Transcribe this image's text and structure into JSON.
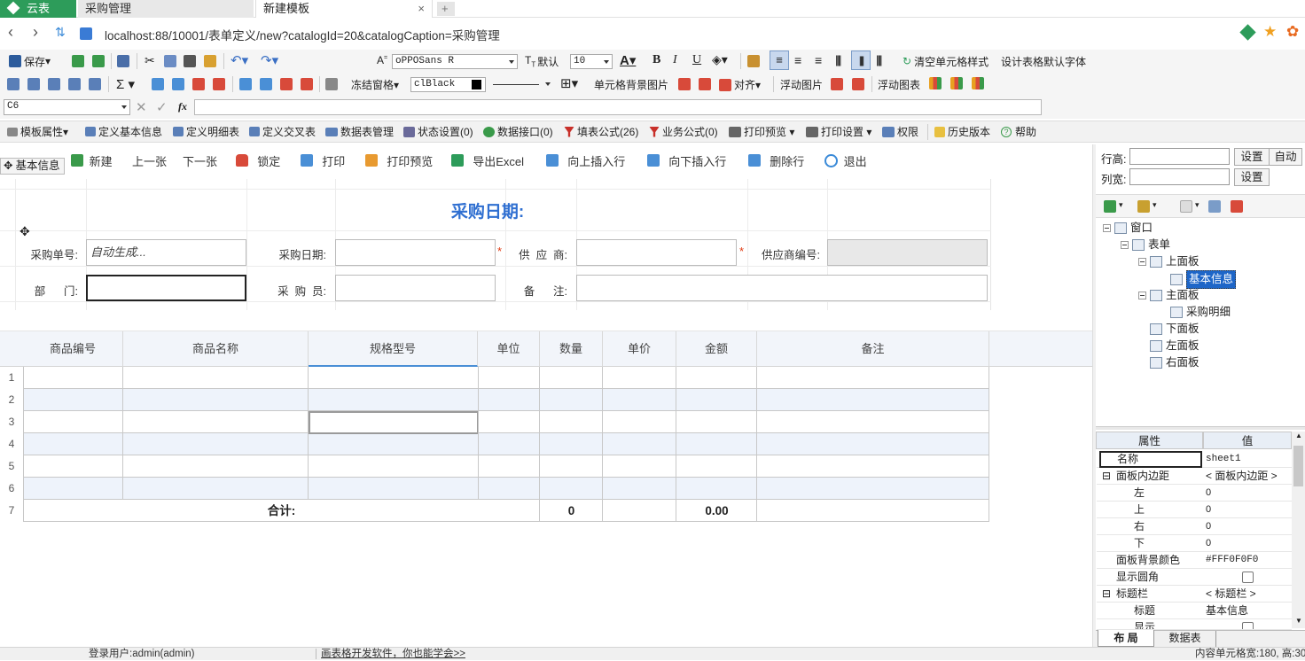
{
  "tabs": [
    {
      "label": "云表"
    },
    {
      "label": "采购管理"
    },
    {
      "label": "新建模板"
    }
  ],
  "address": "localhost:88/10001/表单定义/new?catalogId=20&catalogCaption=采购管理",
  "toolbar1": {
    "save": "保存",
    "font_label": "oPPOSans R",
    "default_label": "默认",
    "size": "10",
    "clear_style": "清空单元格样式",
    "default_font": "设计表格默认字体"
  },
  "toolbar2": {
    "freeze": "冻结窗格",
    "color": "clBlack",
    "cell_bg": "单元格背景图片",
    "align": "对齐",
    "float_img": "浮动图片",
    "float_chart": "浮动图表"
  },
  "formula_bar": {
    "cell_ref": "C6",
    "fx": "fx",
    "value": ""
  },
  "toolbar4": {
    "items": [
      "模板属性",
      "定义基本信息",
      "定义明细表",
      "定义交叉表",
      "数据表管理",
      "状态设置(0)",
      "数据接口(0)",
      "填表公式(26)",
      "业务公式(0)",
      "打印预览",
      "打印设置",
      "权限",
      "历史版本",
      "帮助"
    ]
  },
  "form_actions": {
    "items": [
      "新建",
      "上一张",
      "下一张",
      "锁定",
      "打印",
      "打印预览",
      "导出Excel",
      "向上插入行",
      "向下插入行",
      "删除行",
      "退出"
    ],
    "panel_tag": "基本信息"
  },
  "form": {
    "title": "采购日期:",
    "labels": {
      "order_no": "采购单号:",
      "date": "采购日期:",
      "supplier": "供  应  商:",
      "supplier_no": "供应商编号:",
      "dept": "部      门:",
      "buyer": "采  购  员:",
      "remark": "备      注:"
    },
    "order_no_value": "自动生成...",
    "required_mark": "*"
  },
  "grid": {
    "columns": [
      "商品编号",
      "商品名称",
      "规格型号",
      "单位",
      "数量",
      "单价",
      "金额",
      "备注"
    ],
    "row_numbers": [
      "1",
      "2",
      "3",
      "4",
      "5",
      "6",
      "7"
    ],
    "total_label": "合计:",
    "total_qty": "0",
    "total_amount": "0.00"
  },
  "right_panel": {
    "row_height_label": "行高:",
    "col_width_label": "列宽:",
    "set": "设置",
    "auto": "自动",
    "tree": [
      {
        "label": "窗口"
      },
      {
        "label": "表单"
      },
      {
        "label": "上面板"
      },
      {
        "label": "基本信息"
      },
      {
        "label": "主面板"
      },
      {
        "label": "采购明细"
      },
      {
        "label": "下面板"
      },
      {
        "label": "左面板"
      },
      {
        "label": "右面板"
      }
    ],
    "prop_headers": {
      "attr": "属性",
      "value": "值"
    },
    "props": [
      {
        "name": "名称",
        "value": "sheet1"
      },
      {
        "name": "面板内边距",
        "value": "< 面板内边距 >"
      },
      {
        "name": "左",
        "value": "0"
      },
      {
        "name": "上",
        "value": "0"
      },
      {
        "name": "右",
        "value": "0"
      },
      {
        "name": "下",
        "value": "0"
      },
      {
        "name": "面板背景颜色",
        "value": "#FFF0F0F0"
      },
      {
        "name": "显示圆角",
        "value": ""
      },
      {
        "name": "标题栏",
        "value": "< 标题栏 >"
      },
      {
        "name": "标题",
        "value": "基本信息"
      },
      {
        "name": "显示",
        "value": ""
      }
    ],
    "bottom_tabs": [
      "布 局",
      "数据表"
    ]
  },
  "status": {
    "user": "登录用户:admin(admin)",
    "promo": "画表格开发软件，你也能学会>>",
    "cell_info": "内容单元格宽:180, 高:30"
  },
  "colors": {
    "accent": "#4a8fd6",
    "brand": "#2d9c5a",
    "title": "#2f6fd1",
    "required": "#e03a12"
  }
}
